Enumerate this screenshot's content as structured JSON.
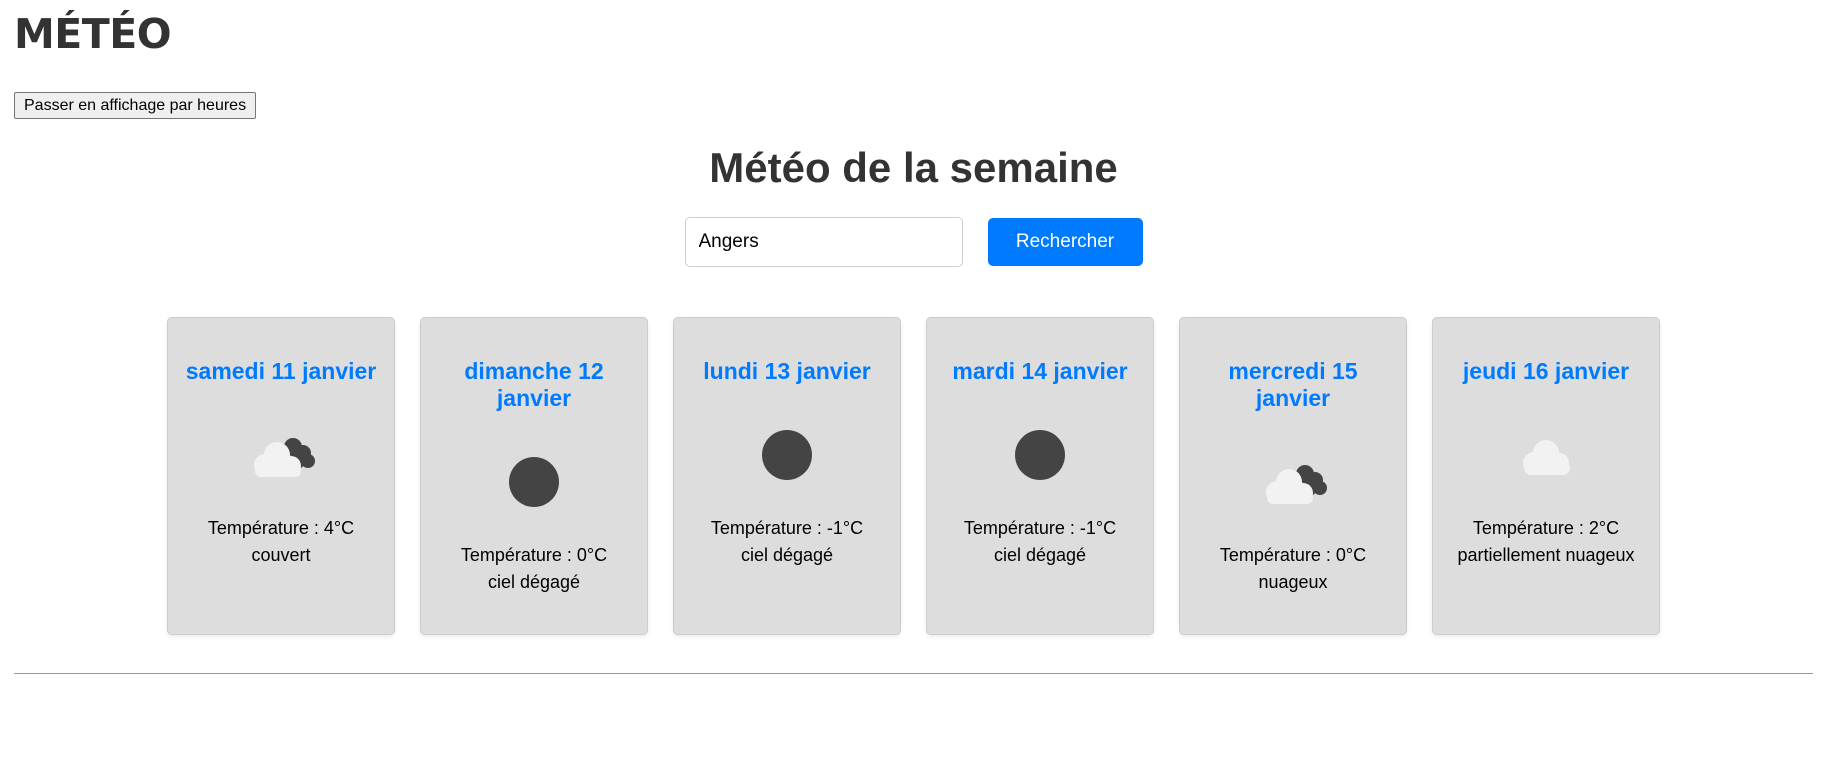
{
  "app": {
    "title": "MÉTÉO",
    "toggle_label": "Passer en affichage par heures"
  },
  "week": {
    "title": "Météo de la semaine"
  },
  "search": {
    "value": "Angers",
    "button_label": "Rechercher"
  },
  "colors": {
    "accent": "#007bff",
    "card_background": "#dddddd",
    "icon_dark": "#444444",
    "icon_light": "#f2f2f2"
  },
  "forecast": [
    {
      "date": "samedi 11 janvier",
      "icon": "dark-cloud-behind-light-cloud-icon",
      "temperature": "Température : 4°C",
      "description": "couvert"
    },
    {
      "date": "dimanche 12 janvier",
      "icon": "dark-sun-icon",
      "temperature": "Température : 0°C",
      "description": "ciel dégagé"
    },
    {
      "date": "lundi 13 janvier",
      "icon": "dark-sun-icon",
      "temperature": "Température : -1°C",
      "description": "ciel dégagé"
    },
    {
      "date": "mardi 14 janvier",
      "icon": "dark-sun-icon",
      "temperature": "Température : -1°C",
      "description": "ciel dégagé"
    },
    {
      "date": "mercredi 15 janvier",
      "icon": "dark-cloud-behind-light-cloud-icon",
      "temperature": "Température : 0°C",
      "description": "nuageux"
    },
    {
      "date": "jeudi 16 janvier",
      "icon": "light-cloud-icon",
      "temperature": "Température : 2°C",
      "description": "partiellement nuageux"
    }
  ]
}
